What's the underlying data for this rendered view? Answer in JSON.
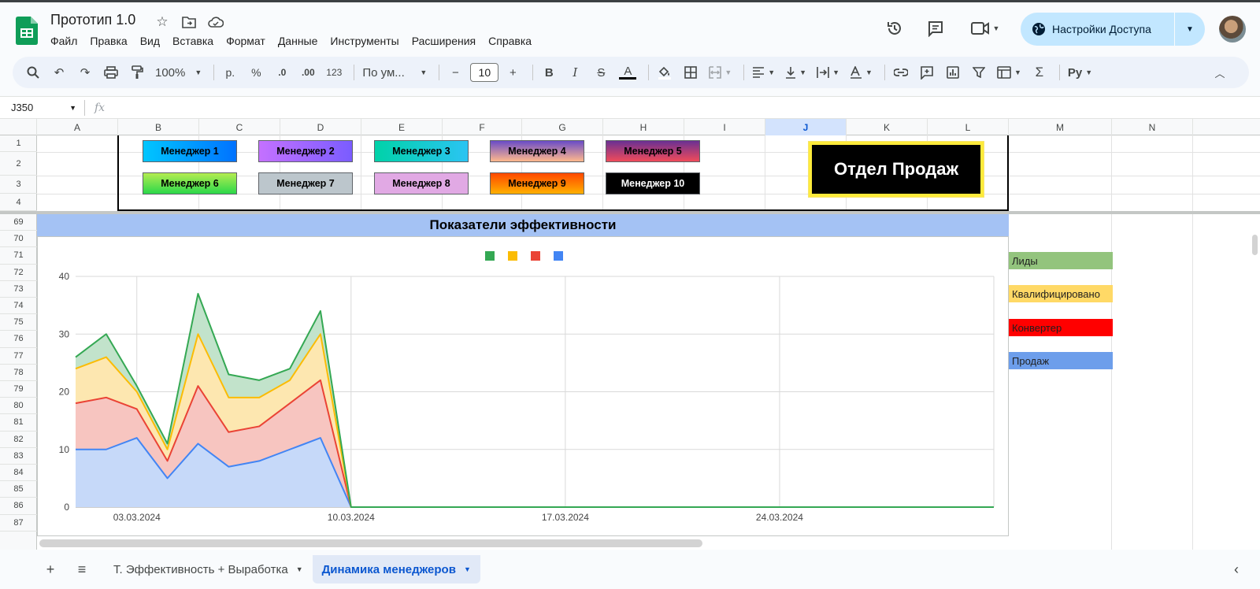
{
  "document": {
    "title": "Прототип 1.0"
  },
  "menu": [
    "Файл",
    "Правка",
    "Вид",
    "Вставка",
    "Формат",
    "Данные",
    "Инструменты",
    "Расширения",
    "Справка"
  ],
  "share": {
    "label": "Настройки Доступа"
  },
  "toolbar": {
    "zoom": "100%",
    "currency": "р.",
    "percent": "%",
    "dec_decrease": ".0",
    "dec_increase": ".00",
    "number_format": "123",
    "font": "По ум...",
    "font_size": "10"
  },
  "formula_bar": {
    "cell_ref": "J350",
    "fx": "fx"
  },
  "grid": {
    "columns": [
      "A",
      "B",
      "C",
      "D",
      "E",
      "F",
      "G",
      "H",
      "I",
      "J",
      "K",
      "L",
      "M",
      "N"
    ],
    "active_column": "J",
    "top_rows": [
      "1",
      "2",
      "3",
      "4"
    ],
    "chart_rows": [
      "69",
      "70",
      "71",
      "72",
      "73",
      "74",
      "75",
      "76",
      "77",
      "78",
      "79",
      "80",
      "81",
      "82",
      "83",
      "84",
      "85",
      "86",
      "87"
    ]
  },
  "managers": [
    {
      "label": "Менеджер 1",
      "bg": "linear-gradient(90deg,#00c6ff,#0072ff)"
    },
    {
      "label": "Менеджер 2",
      "bg": "linear-gradient(90deg,#c471ff,#7a5cff)"
    },
    {
      "label": "Менеджер 3",
      "bg": "linear-gradient(90deg,#00d2a8,#2bc4f3)"
    },
    {
      "label": "Менеджер 4",
      "bg": "linear-gradient(180deg,#6a4cc7,#ffb88c)"
    },
    {
      "label": "Менеджер 5",
      "bg": "linear-gradient(180deg,#6a3093,#f04b5a)"
    },
    {
      "label": "Менеджер 6",
      "bg": "linear-gradient(180deg,#b4ec51,#2bd84a)"
    },
    {
      "label": "Менеджер 7",
      "bg": "#bcc6cc"
    },
    {
      "label": "Менеджер 8",
      "bg": "#e1a9e4"
    },
    {
      "label": "Менеджер 9",
      "bg": "linear-gradient(180deg,#ff4800,#ffb000)"
    },
    {
      "label": "Менеджер 10",
      "bg": "#000000",
      "color": "#ffffff"
    }
  ],
  "department": {
    "label": "Отдел Продаж"
  },
  "chart_header": "Показатели эффективности",
  "side_legend": [
    {
      "label": "Лиды",
      "color": "#93c47d"
    },
    {
      "label": "Квалифицировано",
      "color": "#ffd966"
    },
    {
      "label": "Конвертер",
      "color": "#ff0000"
    },
    {
      "label": "Продаж",
      "color": "#6d9eeb"
    }
  ],
  "chart_data": {
    "type": "area",
    "stacked": true,
    "title": "",
    "x_ticks": [
      "03.03.2024",
      "10.03.2024",
      "17.03.2024",
      "24.03.2024"
    ],
    "x": [
      "01.03.2024",
      "02.03.2024",
      "03.03.2024",
      "04.03.2024",
      "05.03.2024",
      "06.03.2024",
      "07.03.2024",
      "08.03.2024",
      "09.03.2024",
      "10.03.2024",
      "11.03.2024",
      "12.03.2024",
      "13.03.2024",
      "14.03.2024",
      "15.03.2024",
      "16.03.2024",
      "17.03.2024",
      "18.03.2024",
      "19.03.2024",
      "20.03.2024",
      "21.03.2024",
      "22.03.2024",
      "23.03.2024",
      "24.03.2024",
      "25.03.2024",
      "26.03.2024",
      "27.03.2024",
      "28.03.2024",
      "29.03.2024",
      "30.03.2024",
      "31.03.2024"
    ],
    "ylim": [
      0,
      40
    ],
    "y_ticks": [
      0,
      10,
      20,
      30,
      40
    ],
    "grid": true,
    "legend_position": "top",
    "series": [
      {
        "color": "#4285f4",
        "fill": "#c6d9f9",
        "values": [
          10,
          10,
          12,
          5,
          11,
          7,
          8,
          10,
          12,
          0,
          0,
          0,
          0,
          0,
          0,
          0,
          0,
          0,
          0,
          0,
          0,
          0,
          0,
          0,
          0,
          0,
          0,
          0,
          0,
          0,
          0
        ]
      },
      {
        "color": "#ea4335",
        "fill": "#f7c5c0",
        "values": [
          8,
          9,
          5,
          3,
          10,
          6,
          6,
          8,
          10,
          0,
          0,
          0,
          0,
          0,
          0,
          0,
          0,
          0,
          0,
          0,
          0,
          0,
          0,
          0,
          0,
          0,
          0,
          0,
          0,
          0,
          0
        ]
      },
      {
        "color": "#fbbc04",
        "fill": "#fde7b0",
        "values": [
          6,
          7,
          3,
          2,
          9,
          6,
          5,
          4,
          8,
          0,
          0,
          0,
          0,
          0,
          0,
          0,
          0,
          0,
          0,
          0,
          0,
          0,
          0,
          0,
          0,
          0,
          0,
          0,
          0,
          0,
          0
        ]
      },
      {
        "color": "#34a853",
        "fill": "#c2e3cb",
        "values": [
          2,
          4,
          1,
          1,
          7,
          4,
          3,
          2,
          4,
          0,
          0,
          0,
          0,
          0,
          0,
          0,
          0,
          0,
          0,
          0,
          0,
          0,
          0,
          0,
          0,
          0,
          0,
          0,
          0,
          0,
          0
        ]
      }
    ],
    "legend_swatches": [
      "#34a853",
      "#fbbc04",
      "#ea4335",
      "#4285f4"
    ]
  },
  "sheets": [
    {
      "label": "Т. Эффективность + Выработка",
      "active": false
    },
    {
      "label": "Динамика менеджеров",
      "active": true
    }
  ]
}
